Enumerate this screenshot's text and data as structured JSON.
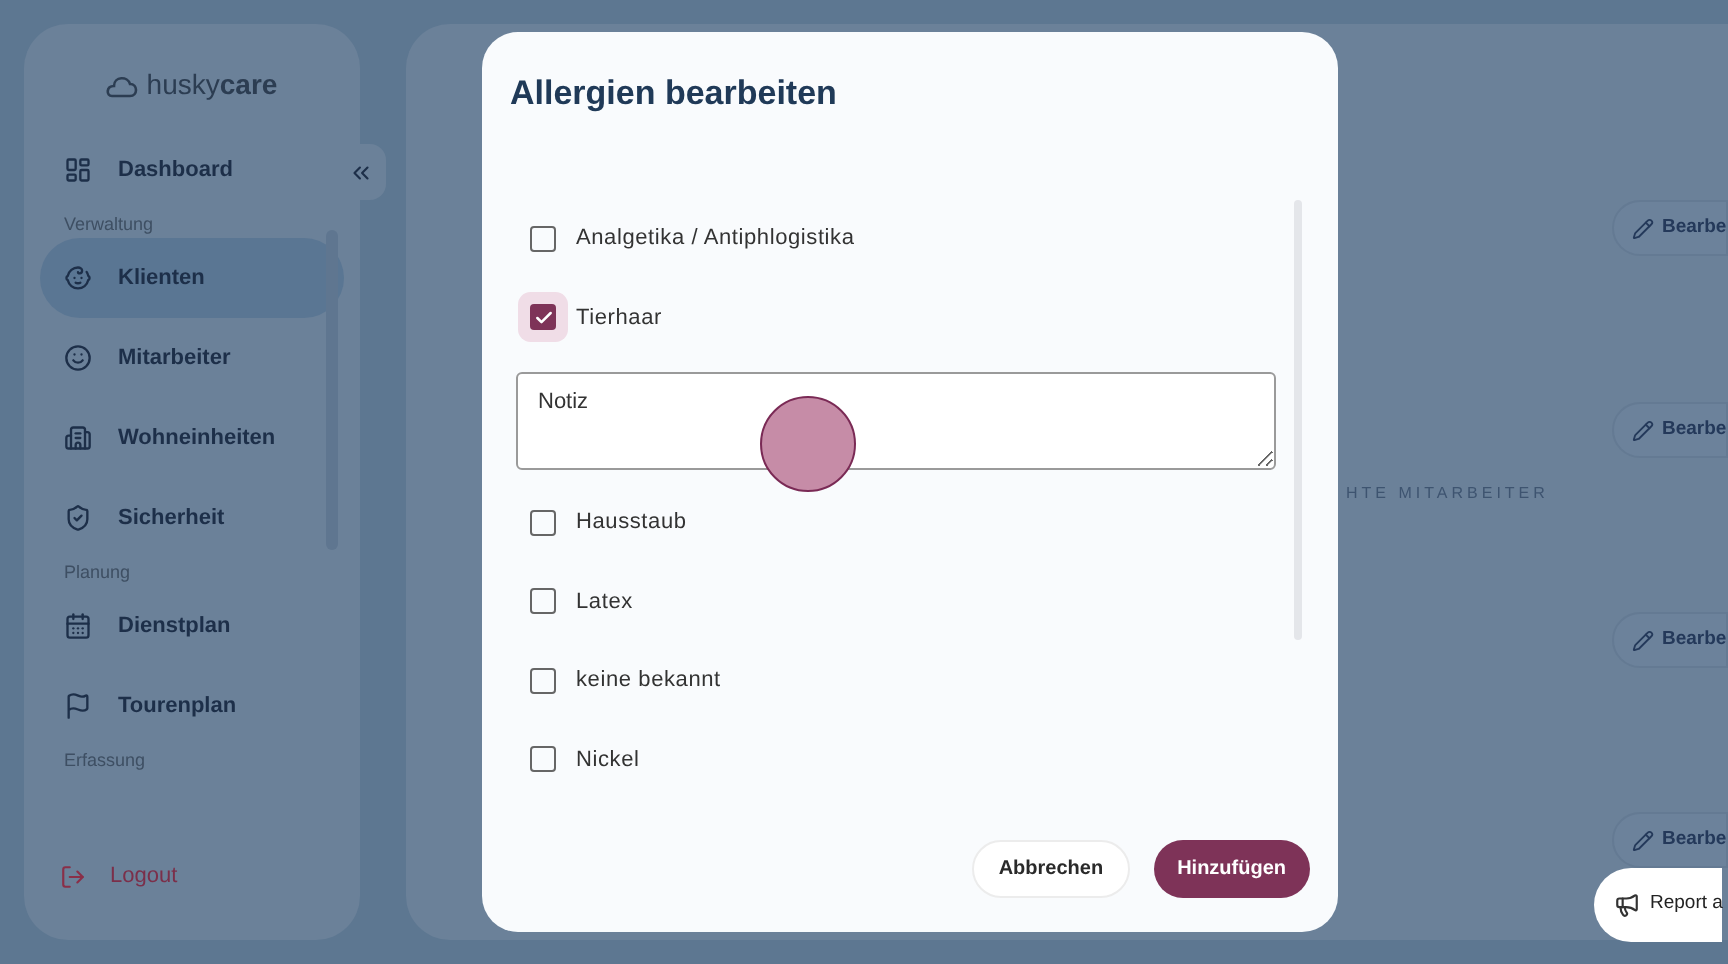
{
  "sidebar": {
    "logo": {
      "prefix": "husky",
      "suffix": "care"
    },
    "items": [
      {
        "kind": "item",
        "label": "Dashboard",
        "selected": false
      },
      {
        "kind": "section",
        "label": "Verwaltung"
      },
      {
        "kind": "item",
        "label": "Klienten",
        "selected": true
      },
      {
        "kind": "item",
        "label": "Mitarbeiter",
        "selected": false
      },
      {
        "kind": "item",
        "label": "Wohneinheiten",
        "selected": false
      },
      {
        "kind": "item",
        "label": "Sicherheit",
        "selected": false
      },
      {
        "kind": "section",
        "label": "Planung"
      },
      {
        "kind": "item",
        "label": "Dienstplan",
        "selected": false
      },
      {
        "kind": "item",
        "label": "Tourenplan",
        "selected": false
      },
      {
        "kind": "section",
        "label": "Erfassung"
      }
    ],
    "logout": "Logout"
  },
  "main": {
    "caption": "HTE MITARBEITER",
    "edit_buttons": [
      "Bearbe",
      "Bearbe",
      "Bearbe",
      "Bearbe"
    ]
  },
  "report_button": "Report a",
  "dialog": {
    "title": "Allergien bearbeiten",
    "options": [
      {
        "kind": "checkbox",
        "label": "Analgetika / Antiphlogistika",
        "checked": false
      },
      {
        "kind": "checkbox",
        "label": "Tierhaar",
        "checked": true
      },
      {
        "kind": "note",
        "placeholder": "Notiz"
      },
      {
        "kind": "checkbox",
        "label": "Hausstaub",
        "checked": false
      },
      {
        "kind": "checkbox",
        "label": "Latex",
        "checked": false
      },
      {
        "kind": "checkbox",
        "label": "keine bekannt",
        "checked": false
      },
      {
        "kind": "checkbox",
        "label": "Nickel",
        "checked": false
      }
    ],
    "buttons": [
      {
        "kind": "secondary",
        "label": "Abbrechen"
      },
      {
        "kind": "primary",
        "label": "Hinzufügen"
      }
    ]
  }
}
